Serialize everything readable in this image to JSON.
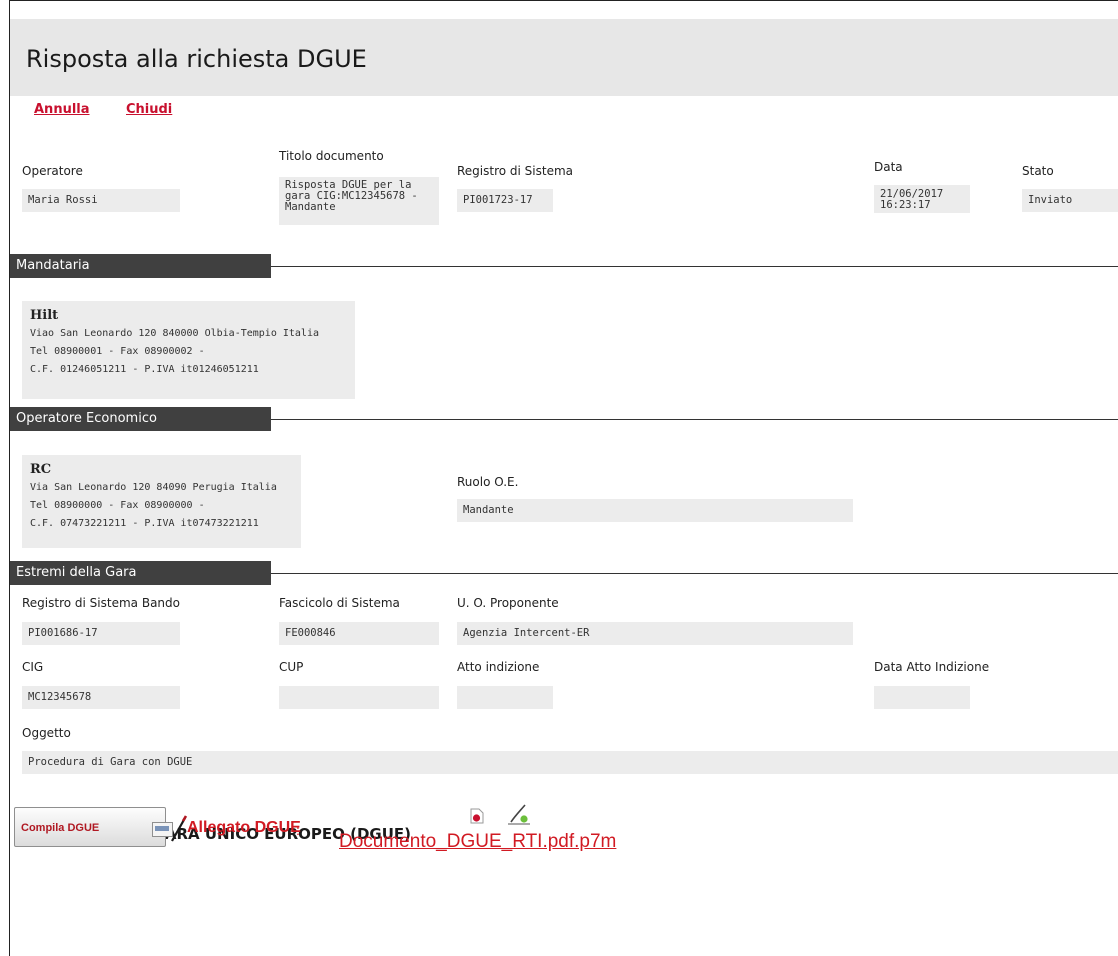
{
  "header": {
    "title": "Risposta alla richiesta DGUE"
  },
  "toolbar": {
    "annulla": "Annulla",
    "chiudi": "Chiudi"
  },
  "document": {
    "operatore_label": "Operatore",
    "operatore_value": "Maria Rossi",
    "titolo_label": "Titolo documento",
    "titolo_value": "Risposta DGUE per la gara CIG:MC12345678 - Mandante",
    "registro_label": "Registro di Sistema",
    "registro_value": "PI001723-17",
    "data_label": "Data",
    "data_value": "21/06/2017 16:23:17",
    "stato_label": "Stato",
    "stato_value": "Inviato"
  },
  "sections": {
    "mandataria": "Mandataria",
    "operatore_economico": "Operatore Economico",
    "estremi_gara": "Estremi della Gara"
  },
  "mandataria": {
    "name": "Hilt",
    "address": "Viao San Leonardo 120 840000 Olbia-Tempio Italia",
    "phone": "Tel 08900001 - Fax 08900002 -",
    "tax": "C.F. 01246051211 - P.IVA it01246051211"
  },
  "operatore_economico": {
    "name": "RC",
    "address": "Via San Leonardo 120 84090 Perugia Italia",
    "phone": "Tel 08900000 - Fax 08900000 -",
    "tax": "C.F. 07473221211 - P.IVA it07473221211",
    "ruolo_label": "Ruolo O.E.",
    "ruolo_value": "Mandante"
  },
  "gara": {
    "registro_bando_label": "Registro di Sistema Bando",
    "registro_bando_value": "PI001686-17",
    "fascicolo_label": "Fascicolo di Sistema",
    "fascicolo_value": "FE000846",
    "uo_label": "U. O. Proponente",
    "uo_value": "Agenzia Intercent-ER",
    "cig_label": "CIG",
    "cig_value": "MC12345678",
    "cup_label": "CUP",
    "cup_value": "",
    "atto_label": "Atto indizione",
    "atto_value": "",
    "data_atto_label": "Data Atto Indizione",
    "data_atto_value": "",
    "oggetto_label": "Oggetto",
    "oggetto_value": "Procedura di Gara con DGUE"
  },
  "dgue": {
    "heading": "DOCUMENTO DI GARA UNICO EUROPEO (DGUE)",
    "compila_label": "Compila DGUE",
    "allegato_label": "Allegato DGUE",
    "allegato_colon": ":",
    "file_name": "Documento_DGUE_RTI.pdf.p7m"
  },
  "icons": {
    "compila": "dgue-edit-icon",
    "pdf": "pdf-file-icon",
    "signature": "digital-signature-icon"
  },
  "colors": {
    "accent_red": "#d11a23",
    "section_tab": "#404040",
    "field_background": "#ececec",
    "title_bar": "#e7e7e7"
  }
}
